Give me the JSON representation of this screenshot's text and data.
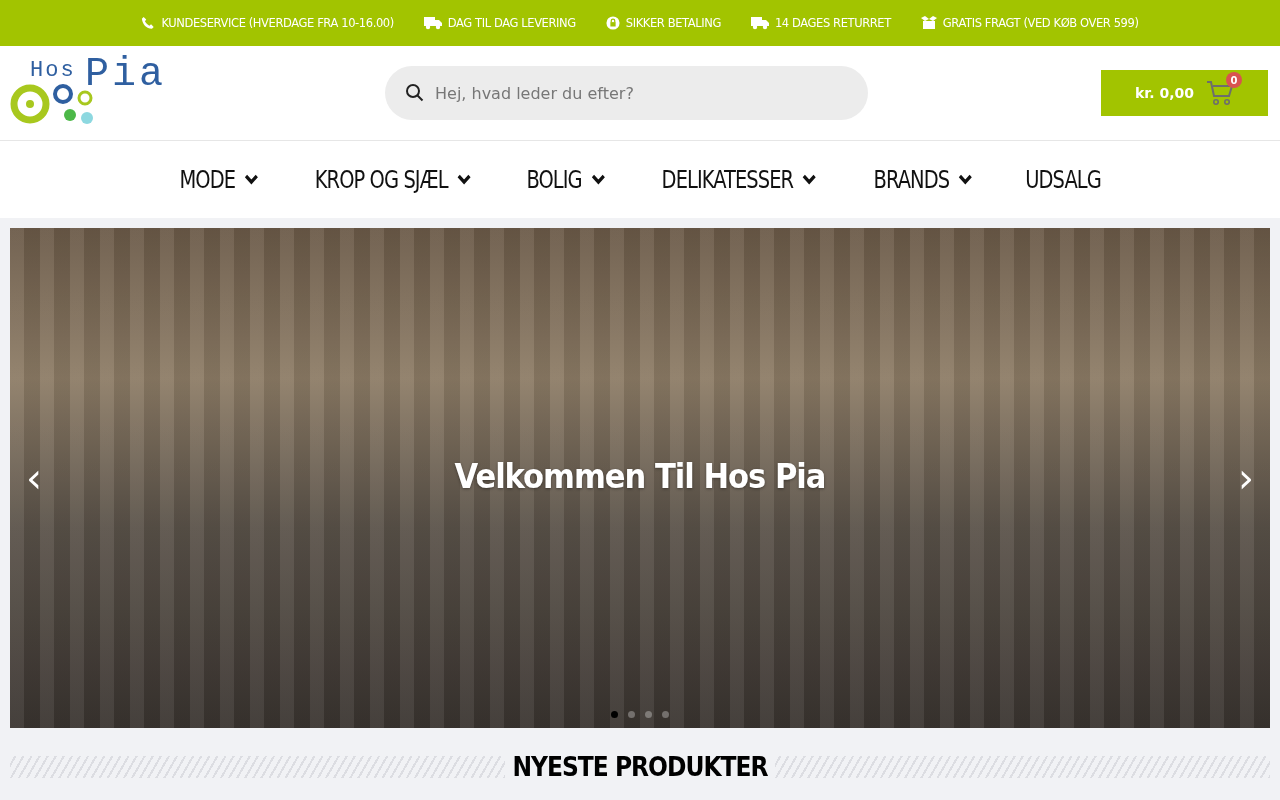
{
  "top_bar": [
    {
      "kind": "phone",
      "text": "KUNDESERVICE (HVERDAGE FRA 10-16.00)"
    },
    {
      "kind": "delivery",
      "text": "DAG TIL DAG LEVERING"
    },
    {
      "kind": "payment",
      "text": "SIKKER BETALING"
    },
    {
      "kind": "delivery",
      "text": "14 DAGES RETURRET"
    },
    {
      "kind": "shipping",
      "text": "GRATIS FRAGT (VED KØB OVER 599)"
    }
  ],
  "logo": {
    "small": "Hos",
    "large": "Pia"
  },
  "search": {
    "placeholder": "Hej, hvad leder du efter?"
  },
  "cart": {
    "total": "kr. 0,00",
    "count": "0"
  },
  "nav": [
    {
      "label": "MODE",
      "dropdown": true
    },
    {
      "label": "KROP OG SJÆL",
      "dropdown": true
    },
    {
      "label": "BOLIG",
      "dropdown": true
    },
    {
      "label": "DELIKATESSER",
      "dropdown": true
    },
    {
      "label": "BRANDS",
      "dropdown": true
    },
    {
      "label": "UDSALG",
      "dropdown": false
    }
  ],
  "hero": {
    "heading": "Velkommen Til Hos Pia",
    "prev": "‹",
    "next": "›",
    "dots": [
      {
        "selected": true
      },
      {
        "selected": false
      },
      {
        "selected": false
      },
      {
        "selected": false
      }
    ]
  },
  "section": {
    "title": "NYESTE PRODUKTER"
  }
}
